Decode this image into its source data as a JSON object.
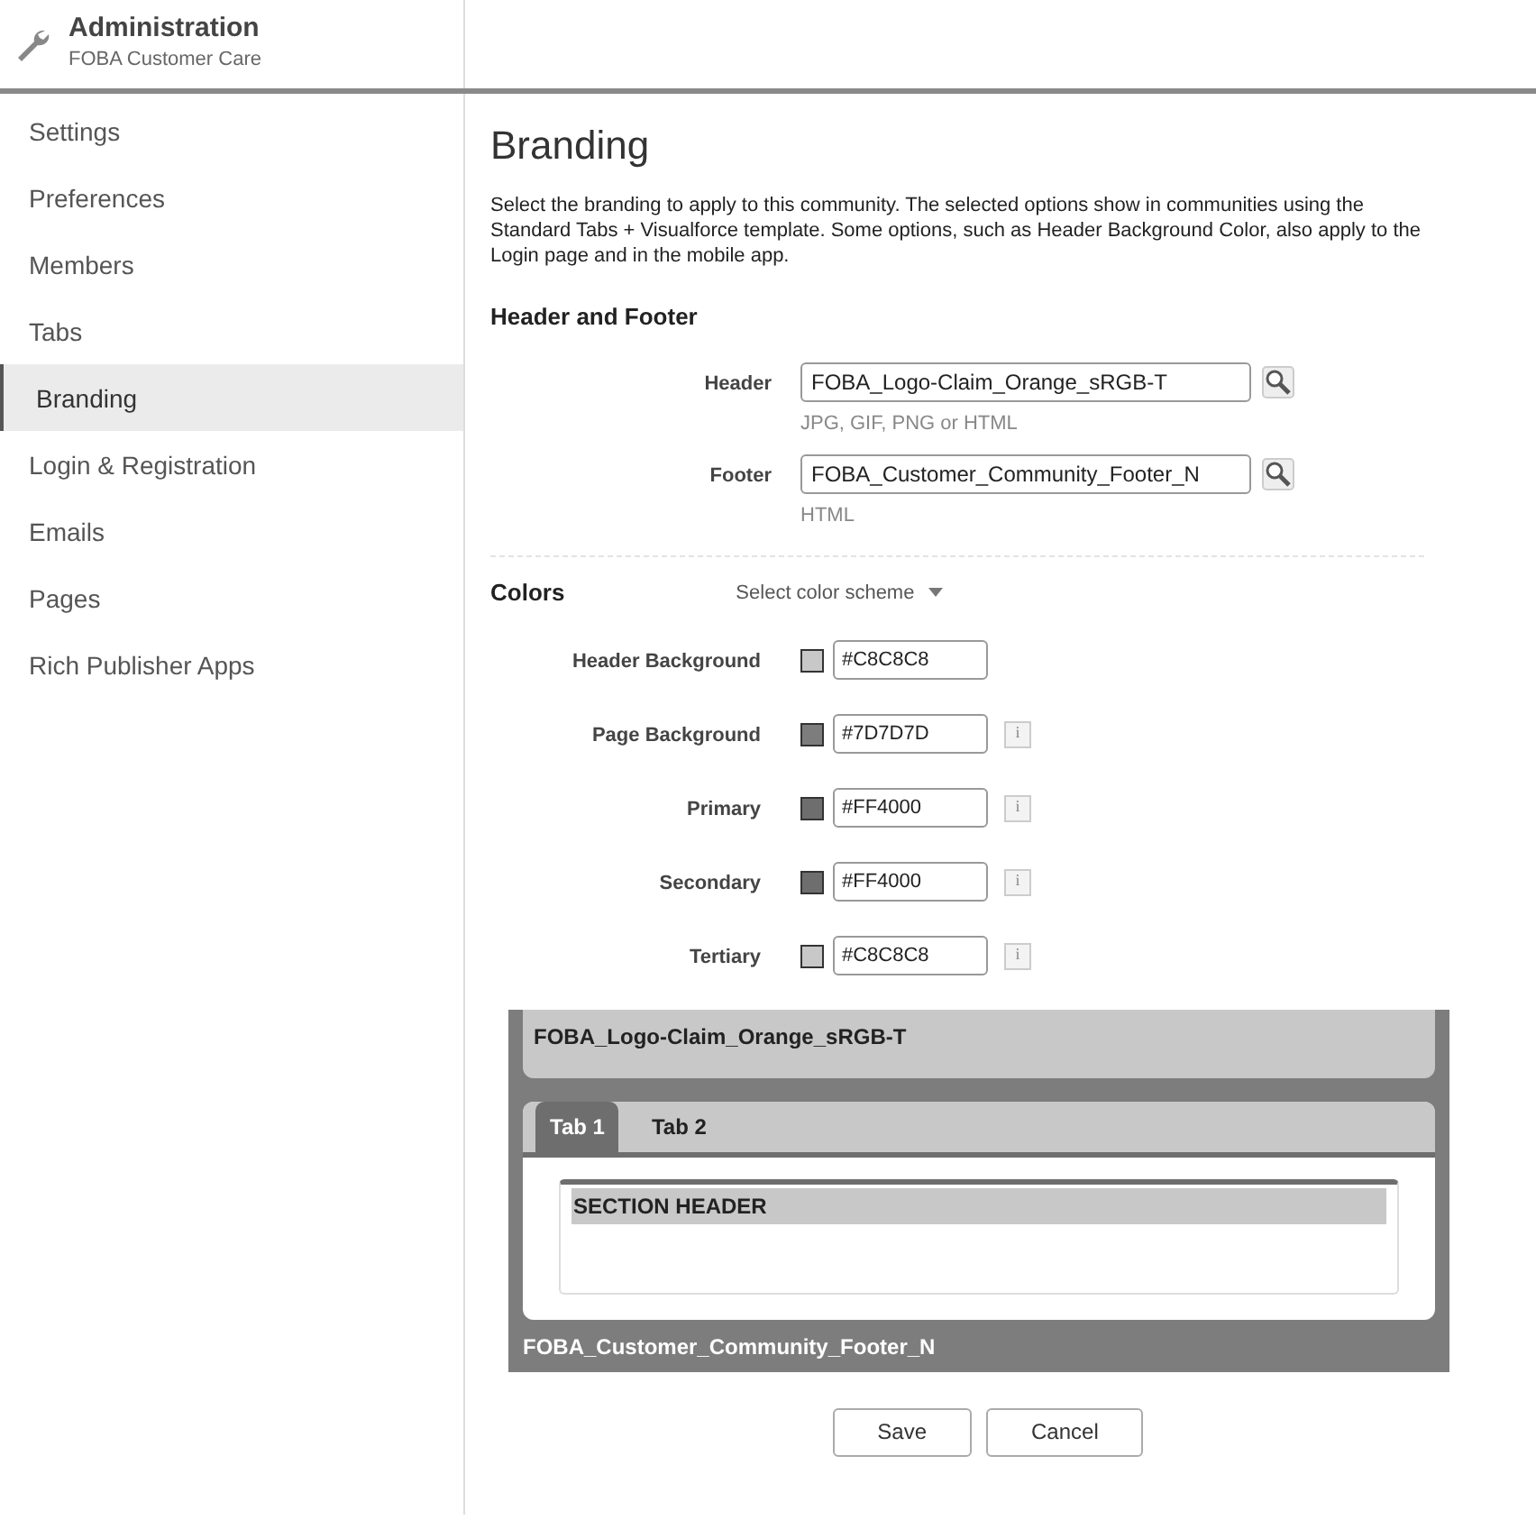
{
  "header": {
    "title": "Administration",
    "subtitle": "FOBA Customer Care"
  },
  "sidebar": {
    "items": [
      {
        "label": "Settings",
        "selected": false
      },
      {
        "label": "Preferences",
        "selected": false
      },
      {
        "label": "Members",
        "selected": false
      },
      {
        "label": "Tabs",
        "selected": false
      },
      {
        "label": "Branding",
        "selected": true
      },
      {
        "label": "Login & Registration",
        "selected": false
      },
      {
        "label": "Emails",
        "selected": false
      },
      {
        "label": "Pages",
        "selected": false
      },
      {
        "label": "Rich Publisher Apps",
        "selected": false
      }
    ]
  },
  "page": {
    "title": "Branding",
    "description": "Select the branding to apply to this community. The selected options show in communities using the Standard Tabs + Visualforce template. Some options, such as Header Background Color, also apply to the Login page and in the mobile app."
  },
  "header_and_footer": {
    "title": "Header and Footer",
    "fields": [
      {
        "label": "Header",
        "value": "FOBA_Logo-Claim_Orange_sRGB-T",
        "hint": "JPG, GIF, PNG or HTML"
      },
      {
        "label": "Footer",
        "value": "FOBA_Customer_Community_Footer_N",
        "hint": "HTML"
      }
    ]
  },
  "colors": {
    "title": "Colors",
    "scheme": "Select color scheme",
    "items": [
      {
        "label": "Header Background",
        "value": "#C8C8C8",
        "color": "#c8c8c8"
      },
      {
        "label": "Page Background",
        "value": "#7D7D7D",
        "color": "#7d7d7d",
        "info": "i"
      },
      {
        "label": "Primary",
        "value": "#FF4000",
        "color": "#6e6e6e",
        "info": "i"
      },
      {
        "label": "Secondary",
        "value": "#FF4000",
        "color": "#6e6e6e",
        "info": "i"
      },
      {
        "label": "Tertiary",
        "value": "#C8C8C8",
        "color": "#c8c8c8",
        "info": "i"
      }
    ]
  },
  "preview": {
    "header": "FOBA_Logo-Claim_Orange_sRGB-T",
    "tabs": [
      {
        "label": "Tab 1",
        "selected": true
      },
      {
        "label": "Tab 2",
        "selected": false
      }
    ],
    "section_header": "SECTION HEADER",
    "footer": "FOBA_Customer_Community_Footer_N"
  },
  "buttons": [
    "Save",
    "Cancel"
  ]
}
